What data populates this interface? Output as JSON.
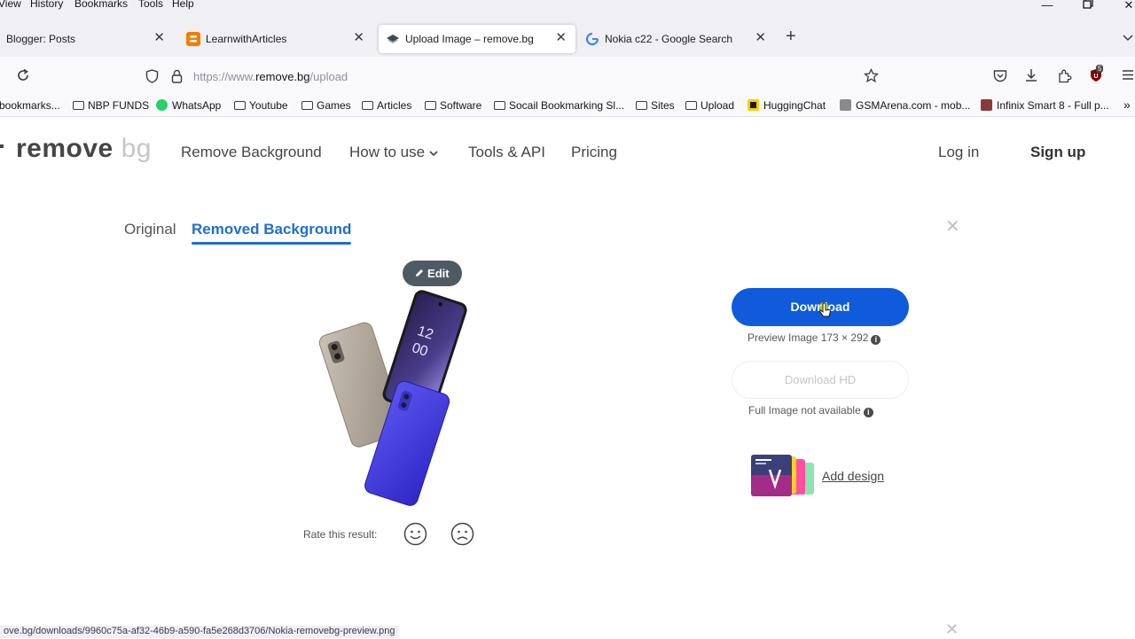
{
  "menu": {
    "items": [
      "View",
      "History",
      "Bookmarks",
      "Tools",
      "Help"
    ]
  },
  "window": {
    "minimize_icon": "minimize-icon",
    "restore_icon": "restore-icon",
    "close_icon": "close-icon"
  },
  "tabs": [
    {
      "title": "Blogger: Posts",
      "icon": "blogger-icon",
      "active": false
    },
    {
      "title": "LearnwithArticles",
      "icon": "blogger-icon",
      "active": false
    },
    {
      "title": "Upload Image – remove.bg",
      "icon": "removebg-icon",
      "active": true
    },
    {
      "title": "Nokia c22 - Google Search",
      "icon": "google-icon",
      "active": false
    }
  ],
  "new_tab_label": "+",
  "navbar": {
    "url_prefix": "https://www.",
    "url_domain": "remove.bg",
    "url_path": "/upload",
    "extension_badge": "5"
  },
  "bookmarks": [
    {
      "label": "bookmarks...",
      "type": "text"
    },
    {
      "label": "NBP FUNDS",
      "type": "folder"
    },
    {
      "label": "WhatsApp",
      "type": "whatsapp"
    },
    {
      "label": "Youtube",
      "type": "folder"
    },
    {
      "label": "Games",
      "type": "folder"
    },
    {
      "label": "Articles",
      "type": "folder"
    },
    {
      "label": "Software",
      "type": "folder"
    },
    {
      "label": "Socail Bookmarking Sl...",
      "type": "folder"
    },
    {
      "label": "Sites",
      "type": "folder"
    },
    {
      "label": "Upload",
      "type": "folder"
    },
    {
      "label": "HuggingChat",
      "type": "hugging"
    },
    {
      "label": "GSMArena.com - mob...",
      "type": "gsm"
    },
    {
      "label": "Infinix Smart 8 - Full p...",
      "type": "gsm"
    }
  ],
  "site": {
    "logo_main": "remove",
    "logo_suffix": "bg",
    "nav": [
      "Remove Background",
      "How to use",
      "Tools & API",
      "Pricing"
    ],
    "login": "Log in",
    "signup": "Sign up"
  },
  "result": {
    "tab_original": "Original",
    "tab_removed": "Removed Background",
    "edit_label": "Edit",
    "download_label": "Download",
    "preview_note": "Preview Image 173 × 292",
    "download_hd_label": "Download HD",
    "full_image_note": "Full Image not available",
    "add_design_label": "Add design",
    "rate_label": "Rate this result:",
    "phone_time_h": "12",
    "phone_time_m": "00"
  },
  "status_bar": "ove.bg/downloads/9960c75a-af32-46b9-a590-fa5e268d3706/Nokia-removebg-preview.png",
  "colors": {
    "accent": "#0f5bdc",
    "tab_active": "#1d6fd1",
    "edit_btn": "#4f5b62"
  }
}
